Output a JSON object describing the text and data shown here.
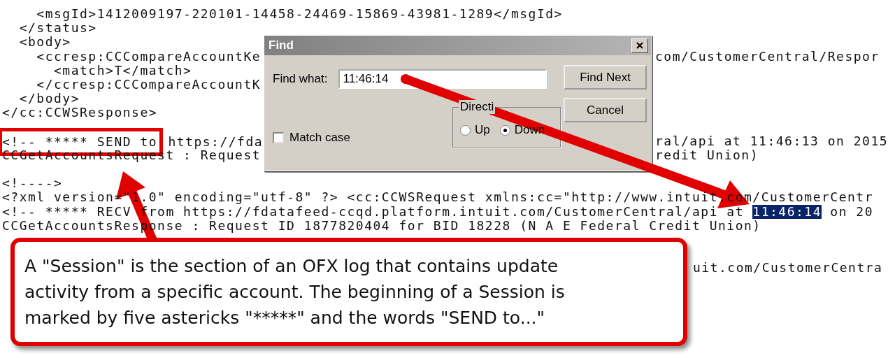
{
  "editor": {
    "lines": [
      {
        "kind": "full",
        "text": "    <msgId>1412009197-220101-14458-24469-15869-43981-1289</msgId>"
      },
      {
        "kind": "full",
        "text": "  </status>"
      },
      {
        "kind": "full",
        "text": "  <body>"
      },
      {
        "kind": "dialog",
        "left": "    <ccresp:CCCompareAccountKe",
        "right": "com/CustomerCentral/Respor"
      },
      {
        "kind": "dialog",
        "left": "      <match>T</match>"
      },
      {
        "kind": "dialog",
        "left": "    </ccresp:CCCompareAccountK"
      },
      {
        "kind": "dialog",
        "left": "  </body>"
      },
      {
        "kind": "full",
        "text": "</cc:CCWSResponse>"
      },
      {
        "kind": "blank"
      },
      {
        "kind": "framed",
        "framed": "<!-- ***** SEND to",
        "left": " https://fda",
        "right": "ral/api at 11:46:13 on 2015"
      },
      {
        "kind": "dialog",
        "left": "CCGetAccountsRequest : Request",
        "right": "redit Union)"
      },
      {
        "kind": "blank"
      },
      {
        "kind": "full",
        "text": "<!---->"
      },
      {
        "kind": "full",
        "text": "<?xml version=\"1.0\" encoding=\"utf-8\" ?> <cc:CCWSRequest xmlns:cc=\"http://www.intuit.com/CustomerCentr"
      },
      {
        "kind": "match",
        "before": "<!-- ***** RECV from https://fdatafeed-ccqd.platform.intuit.com/CustomerCentral/api at ",
        "match": "11:46:14",
        "after": " on 20"
      },
      {
        "kind": "full",
        "text": "CCGetAccountsResponse : Request ID 1877820404 for BID 18228 (N A E Federal Credit Union)"
      },
      {
        "kind": "blank"
      },
      {
        "kind": "blank"
      },
      {
        "kind": "callout",
        "right": "uit.com/CustomerCentra"
      }
    ]
  },
  "find_dialog": {
    "title": "Find",
    "find_label": "Find what:",
    "value": "11:46:14",
    "buttons": [
      "Find Next",
      "Cancel"
    ],
    "match_case": {
      "label": "Match case",
      "checked": false
    },
    "direction": {
      "label": "Directi",
      "options": [
        {
          "label": "Up",
          "selected": false
        },
        {
          "label": "Down",
          "selected": true
        }
      ]
    }
  },
  "callout": {
    "text": "A \"Session\" is the section of an OFX log that contains update activity from a specific account. The beginning of a Session is marked by five astericks \"*****\" and the words \"SEND to...\""
  }
}
